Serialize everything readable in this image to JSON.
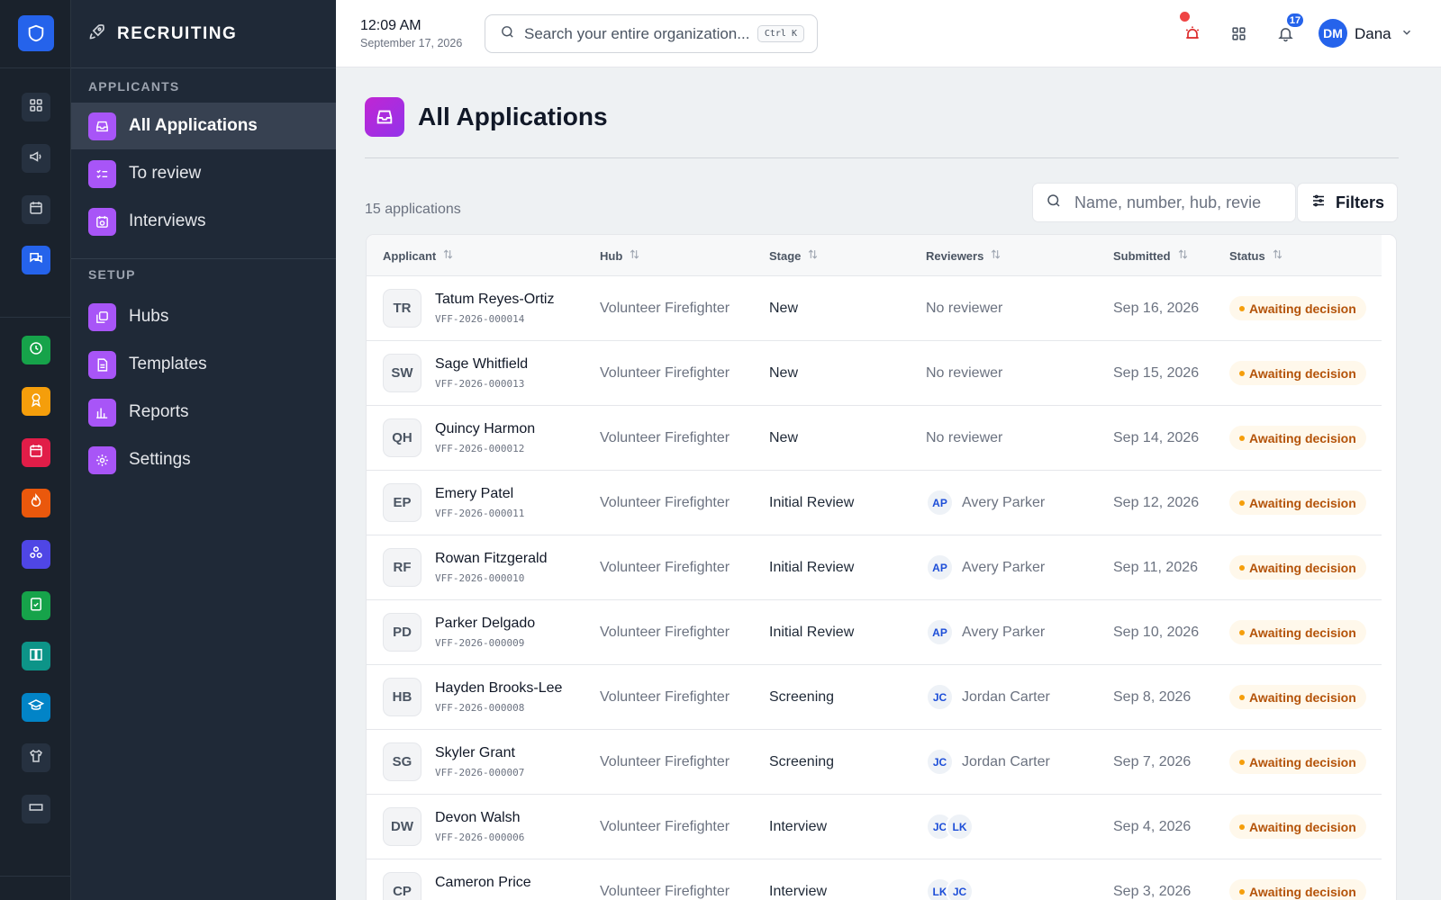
{
  "app": {
    "section_title": "RECRUITING"
  },
  "rail": {
    "items": [
      {
        "icon": "grid-icon",
        "color": "#263140"
      },
      {
        "icon": "megaphone-icon",
        "color": "#263140"
      },
      {
        "icon": "calendar-icon",
        "color": "#263140"
      },
      {
        "icon": "chat-icon",
        "color": "#2563eb"
      },
      {
        "icon": "clock-icon",
        "color": "#16a34a"
      },
      {
        "icon": "award-icon",
        "color": "#f59e0b"
      },
      {
        "icon": "calendar-event-icon",
        "color": "#e11d48"
      },
      {
        "icon": "flame-icon",
        "color": "#ea580c"
      },
      {
        "icon": "hierarchy-icon",
        "color": "#4f46e5"
      },
      {
        "icon": "clipboard-check-icon",
        "color": "#16a34a"
      },
      {
        "icon": "book-icon",
        "color": "#0d9488"
      },
      {
        "icon": "graduation-cap-icon",
        "color": "#0284c7"
      },
      {
        "icon": "shirt-icon",
        "color": "#263140"
      },
      {
        "icon": "ticket-icon",
        "color": "#263140"
      }
    ]
  },
  "sidebar": {
    "sections": [
      {
        "label": "APPLICANTS",
        "items": [
          "All Applications",
          "To review",
          "Interviews"
        ]
      },
      {
        "label": "SETUP",
        "items": [
          "Hubs",
          "Templates",
          "Reports",
          "Settings"
        ]
      }
    ]
  },
  "topbar": {
    "time": "12:09 AM",
    "date": "September 17, 2026",
    "search_placeholder": "Search your entire organization...",
    "search_shortcut": "Ctrl K",
    "notification_count": "17",
    "user_initials": "DM",
    "user_name": "Dana"
  },
  "main": {
    "title": "All Applications",
    "count_text": "15 applications",
    "search_placeholder": "Name, number, hub, revie",
    "filters_label": "Filters",
    "columns": [
      "Applicant",
      "Hub",
      "Stage",
      "Reviewers",
      "Submitted",
      "Status"
    ],
    "rows": [
      {
        "initials": "TR",
        "name": "Tatum Reyes-Ortiz",
        "id": "VFF-2026-000014",
        "hub": "Volunteer Firefighter",
        "stage": "New",
        "reviewer_text": "No reviewer",
        "reviewers": [],
        "submitted": "Sep 16, 2026",
        "status": "Awaiting decision"
      },
      {
        "initials": "SW",
        "name": "Sage Whitfield",
        "id": "VFF-2026-000013",
        "hub": "Volunteer Firefighter",
        "stage": "New",
        "reviewer_text": "No reviewer",
        "reviewers": [],
        "submitted": "Sep 15, 2026",
        "status": "Awaiting decision"
      },
      {
        "initials": "QH",
        "name": "Quincy Harmon",
        "id": "VFF-2026-000012",
        "hub": "Volunteer Firefighter",
        "stage": "New",
        "reviewer_text": "No reviewer",
        "reviewers": [],
        "submitted": "Sep 14, 2026",
        "status": "Awaiting decision"
      },
      {
        "initials": "EP",
        "name": "Emery Patel",
        "id": "VFF-2026-000011",
        "hub": "Volunteer Firefighter",
        "stage": "Initial Review",
        "reviewer_text": "Avery Parker",
        "reviewers": [
          "AP"
        ],
        "submitted": "Sep 12, 2026",
        "status": "Awaiting decision"
      },
      {
        "initials": "RF",
        "name": "Rowan Fitzgerald",
        "id": "VFF-2026-000010",
        "hub": "Volunteer Firefighter",
        "stage": "Initial Review",
        "reviewer_text": "Avery Parker",
        "reviewers": [
          "AP"
        ],
        "submitted": "Sep 11, 2026",
        "status": "Awaiting decision"
      },
      {
        "initials": "PD",
        "name": "Parker Delgado",
        "id": "VFF-2026-000009",
        "hub": "Volunteer Firefighter",
        "stage": "Initial Review",
        "reviewer_text": "Avery Parker",
        "reviewers": [
          "AP"
        ],
        "submitted": "Sep 10, 2026",
        "status": "Awaiting decision"
      },
      {
        "initials": "HB",
        "name": "Hayden Brooks-Lee",
        "id": "VFF-2026-000008",
        "hub": "Volunteer Firefighter",
        "stage": "Screening",
        "reviewer_text": "Jordan Carter",
        "reviewers": [
          "JC"
        ],
        "submitted": "Sep 8, 2026",
        "status": "Awaiting decision"
      },
      {
        "initials": "SG",
        "name": "Skyler Grant",
        "id": "VFF-2026-000007",
        "hub": "Volunteer Firefighter",
        "stage": "Screening",
        "reviewer_text": "Jordan Carter",
        "reviewers": [
          "JC"
        ],
        "submitted": "Sep 7, 2026",
        "status": "Awaiting decision"
      },
      {
        "initials": "DW",
        "name": "Devon Walsh",
        "id": "VFF-2026-000006",
        "hub": "Volunteer Firefighter",
        "stage": "Interview",
        "reviewer_text": "",
        "reviewers": [
          "JC",
          "LK"
        ],
        "submitted": "Sep 4, 2026",
        "status": "Awaiting decision"
      },
      {
        "initials": "CP",
        "name": "Cameron Price",
        "id": "",
        "hub": "Volunteer Firefighter",
        "stage": "Interview",
        "reviewer_text": "",
        "reviewers": [
          "LK",
          "JC"
        ],
        "submitted": "Sep 3, 2026",
        "status": "Awaiting decision"
      }
    ]
  }
}
